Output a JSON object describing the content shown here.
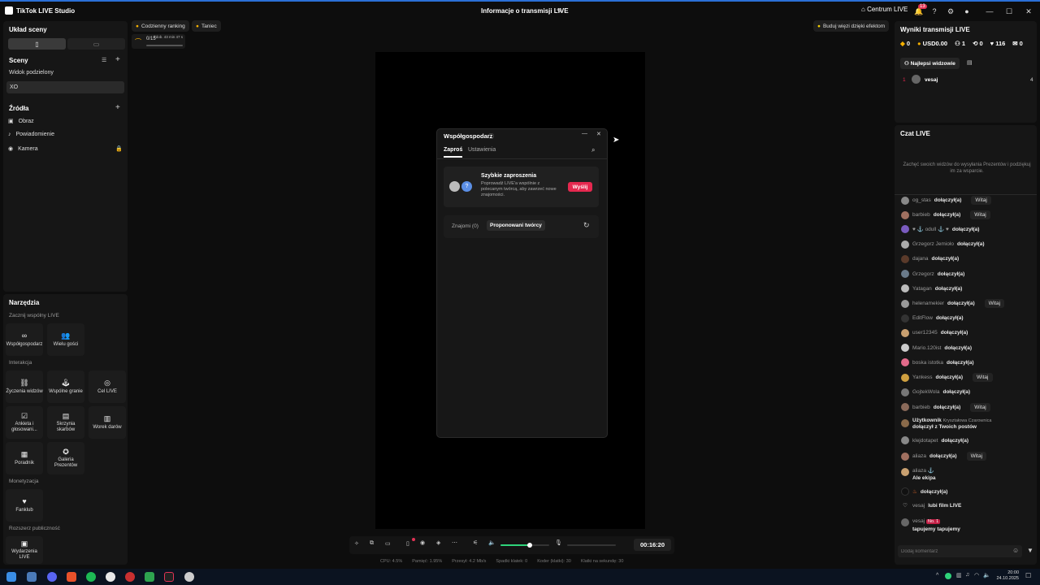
{
  "app": {
    "name": "TikTok LIVE Studio",
    "title": "Informacje o transmisji LIVE",
    "center_link": "Centrum LIVE",
    "notif_count": "13"
  },
  "scene_layout": {
    "title": "Układ sceny"
  },
  "scenes": {
    "title": "Sceny",
    "items": [
      "Widok podzielony",
      "XO"
    ]
  },
  "sources": {
    "title": "Źródła",
    "items": [
      "Obraz",
      "Powiadomienie",
      "Kamera"
    ]
  },
  "tools": {
    "title": "Narzędzia",
    "sections": [
      {
        "title": "Zacznij wspólny LIVE",
        "items": [
          "Współgospodarz",
          "Wielu gości"
        ]
      },
      {
        "title": "Interakcja",
        "items": [
          "Życzenia widzów",
          "Wspólne granie",
          "Cel LIVE",
          "Ankieta i głosowani...",
          "Skrzynia skarbów",
          "Worek darów",
          "Poradnik",
          "Galeria Prezentów"
        ]
      },
      {
        "title": "Monetyzacja",
        "items": [
          "Fanklub"
        ]
      },
      {
        "title": "Rozszerz publiczność",
        "items": [
          "Wydarzenia LIVE"
        ]
      }
    ]
  },
  "preview": {
    "ranking": "Codzienny ranking",
    "dance": "Taniec",
    "effects": "Buduj więzi dzięki efektom",
    "mini_time": "0/15",
    "mini_sub": "Zdob. 43 min 47 s"
  },
  "dialog": {
    "title": "Współgospodarz",
    "tabs": [
      "Zaproś",
      "Ustawienia"
    ],
    "quick_title": "Szybkie zaproszenia",
    "quick_desc": "Poprowadź LIVE'a wspólnie z polecanym twórcą, aby zawrzeć nowe znajomości.",
    "send": "Wyślij",
    "friends": "Znajomi (0)",
    "suggested": "Proponowani twórcy",
    "avatar_q": "?"
  },
  "controls": {
    "time": "00:16:20",
    "volume_level": 0.6
  },
  "status": {
    "cpu": "CPU:  4.5%",
    "mem": "Pamięć:  1.95%",
    "bitrate": "Przesył:  4.2 Mb/s",
    "drops": "Spadki klatek:  0",
    "encoder": "Koder (klatki):  30",
    "fps": "Klatki na sekundę:  30"
  },
  "results": {
    "title": "Wyniki transmisji LIVE",
    "stats": [
      "0",
      "USD0.00",
      "1",
      "0",
      "116",
      "0"
    ],
    "top_viewers": "Najlepsi widzowie",
    "top": [
      {
        "rank": "1",
        "name": "vesaj",
        "value": "4"
      }
    ]
  },
  "chat": {
    "title": "Czat LIVE",
    "hint": "Zachęć swoich widzów do wysyłania Prezentów i podziękuj im za wsparcie.",
    "joined": "dołączył(a)",
    "witaj": "Witaj",
    "rows": [
      {
        "name": "og_stas",
        "msg": "dołączył(a)",
        "witaj": true
      },
      {
        "name": "barbieb",
        "msg": "dołączył(a)",
        "witaj": true
      },
      {
        "name": "♥ ⚓ odull ⚓ ♥",
        "msg": "dołączył(a)",
        "witaj": false
      },
      {
        "name": "Grzegorz Jemioło",
        "msg": "dołączył(a)",
        "witaj": false
      },
      {
        "name": "dajana",
        "msg": "dołączył(a)",
        "witaj": false
      },
      {
        "name": "Grzegorz",
        "msg": "dołączył(a)",
        "witaj": false
      },
      {
        "name": "Yatagan",
        "msg": "dołączył(a)",
        "witaj": false
      },
      {
        "name": "helenamekier",
        "msg": "dołączył(a)",
        "witaj": true
      },
      {
        "name": "EditFlow",
        "msg": "dołączył(a)",
        "witaj": false
      },
      {
        "name": "user12345",
        "msg": "dołączył(a)",
        "witaj": false
      },
      {
        "name": "Mario.120ist",
        "msg": "dołączył(a)",
        "witaj": false
      },
      {
        "name": "boska istotka",
        "msg": "dołączył(a)",
        "witaj": false
      },
      {
        "name": "Yankess",
        "msg": "dołączył(a)",
        "witaj": true
      },
      {
        "name": "GojtekWola",
        "msg": "dołączył(a)",
        "witaj": false
      },
      {
        "name": "barbieb",
        "msg": "dołączył(a)",
        "witaj": true
      }
    ],
    "user_row": {
      "name": "Użytkownik",
      "extra": "Kryształowa Czarownica",
      "msg": "dołączył z Twoich postów"
    },
    "rows2": [
      {
        "name": "klejdotapet",
        "msg": "dołączył(a)",
        "witaj": false
      },
      {
        "name": "aliaza",
        "msg": "dołączył(a)",
        "witaj": true
      }
    ],
    "aliaza_msg": {
      "name": "aliaza",
      "msg": "Ale ekipa"
    },
    "fire_row": {
      "msg": "dołączył(a)"
    },
    "vesaj1": {
      "name": "vesaj",
      "msg": "lubi film LIVE"
    },
    "vesaj2": {
      "name": "vesaj",
      "badge": "No. 1",
      "msg": "tapujemy tapujemy"
    },
    "input_placeholder": "Dodaj komentarz"
  },
  "taskbar": {
    "time": "20:00",
    "date": "24.10.2025"
  }
}
